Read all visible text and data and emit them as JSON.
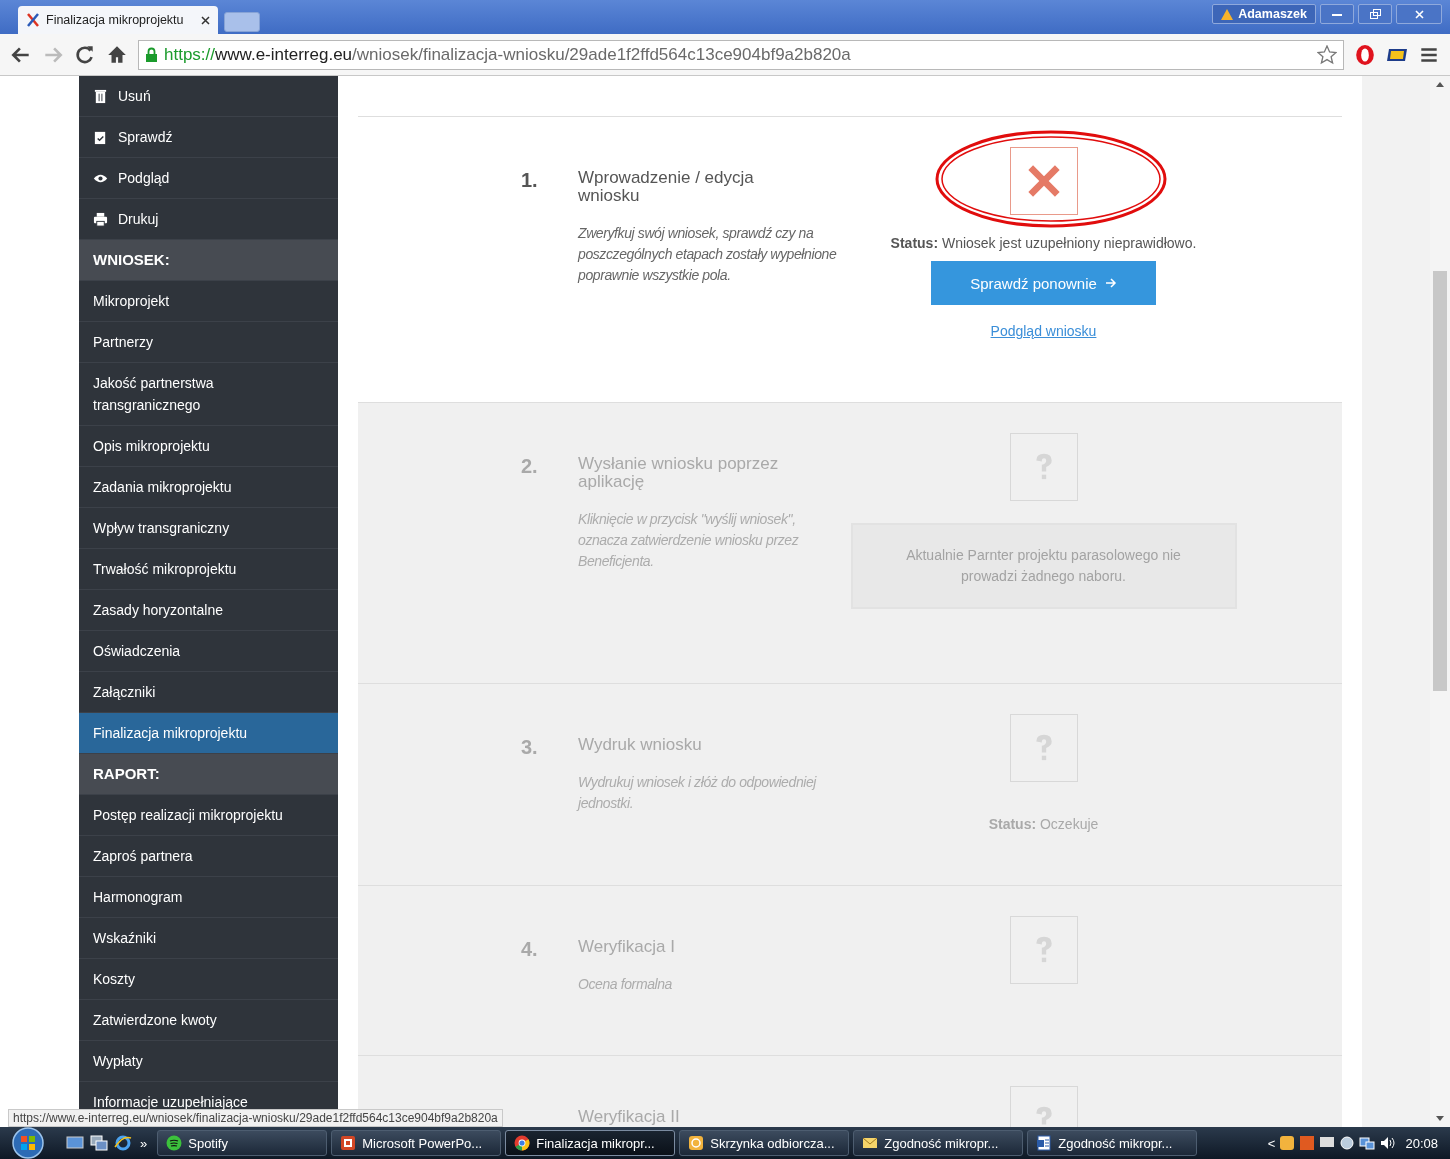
{
  "browser": {
    "tab": {
      "title": "Finalizacja mikroprojektu",
      "selected": true
    },
    "user": "Adamaszek",
    "url": {
      "scheme": "https://",
      "host": "www.e-interreg.eu",
      "path": "/wniosek/finalizacja-wniosku/29ade1f2ffd564c13ce904bf9a2b820a"
    }
  },
  "sidebar": {
    "items": [
      {
        "kind": "action",
        "label": "Usuń"
      },
      {
        "kind": "action",
        "label": "Sprawdź"
      },
      {
        "kind": "action",
        "label": "Podgląd"
      },
      {
        "kind": "action",
        "label": "Drukuj"
      },
      {
        "kind": "header",
        "label": "WNIOSEK:"
      },
      {
        "kind": "link",
        "label": "Mikroprojekt",
        "selected": false
      },
      {
        "kind": "link",
        "label": "Partnerzy",
        "selected": false
      },
      {
        "kind": "link",
        "label": "Jakość partnerstwa transgranicznego",
        "selected": false
      },
      {
        "kind": "link",
        "label": "Opis mikroprojektu",
        "selected": false
      },
      {
        "kind": "link",
        "label": "Zadania mikroprojektu",
        "selected": false
      },
      {
        "kind": "link",
        "label": "Wpływ transgraniczny",
        "selected": false
      },
      {
        "kind": "link",
        "label": "Trwałość mikroprojektu",
        "selected": false
      },
      {
        "kind": "link",
        "label": "Zasady horyzontalne",
        "selected": false
      },
      {
        "kind": "link",
        "label": "Oświadczenia",
        "selected": false
      },
      {
        "kind": "link",
        "label": "Załączniki",
        "selected": false
      },
      {
        "kind": "link",
        "label": "Finalizacja mikroprojektu",
        "selected": true
      },
      {
        "kind": "header",
        "label": "RAPORT:"
      },
      {
        "kind": "link",
        "label": "Postęp realizacji mikroprojektu",
        "selected": false
      },
      {
        "kind": "link",
        "label": "Zaproś partnera",
        "selected": false
      },
      {
        "kind": "link",
        "label": "Harmonogram",
        "selected": false
      },
      {
        "kind": "link",
        "label": "Wskaźniki",
        "selected": false
      },
      {
        "kind": "link",
        "label": "Koszty",
        "selected": false
      },
      {
        "kind": "link",
        "label": "Zatwierdzone kwoty",
        "selected": false
      },
      {
        "kind": "link",
        "label": "Wypłaty",
        "selected": false
      },
      {
        "kind": "link",
        "label": "Informacje uzupełniające",
        "selected": false
      }
    ]
  },
  "steps": [
    {
      "number": "1.",
      "title": "Wprowadzenie / edycja wniosku",
      "description": "Zweryfkuj swój wniosek, sprawdź czy na poszczególnych etapach zostały wypełnione poprawnie wszystkie pola.",
      "active": true,
      "kind": "error",
      "highlighted": true,
      "status_label": "Status:",
      "status_text": "Wniosek jest uzupełniony nieprawidłowo.",
      "button": "Sprawdź ponownie",
      "link": "Podgląd wniosku"
    },
    {
      "number": "2.",
      "title": "Wysłanie wniosku poprzez aplikację",
      "description": "Kliknięcie w przycisk \"wyślij wniosek\", oznacza zatwierdzenie wniosku przez Beneficjenta.",
      "active": false,
      "kind": "pending",
      "highlighted": false,
      "notice": "Aktualnie Parnter projektu parasolowego nie prowadzi żadnego naboru."
    },
    {
      "number": "3.",
      "title": "Wydruk wniosku",
      "description": "Wydrukuj wniosek i złóż do odpowiedniej jednostki.",
      "active": false,
      "kind": "pending",
      "highlighted": false,
      "status_label": "Status:",
      "status_text": "Oczekuje"
    },
    {
      "number": "4.",
      "title": "Weryfikacja I",
      "description": "Ocena formalna",
      "active": false,
      "kind": "pending",
      "highlighted": false
    },
    {
      "title": "Weryfikacja II",
      "active": false,
      "kind": "pending",
      "highlighted": false
    }
  ],
  "status_bubble": "https://www.e-interreg.eu/wniosek/finalizacja-wniosku/29ade1f2ffd564c13ce904bf9a2b820a",
  "taskbar": {
    "items": [
      {
        "label": "Spotify",
        "selected": false
      },
      {
        "label": "Microsoft PowerPo...",
        "selected": false
      },
      {
        "label": "Finalizacja mikropr...",
        "selected": true
      },
      {
        "label": "Skrzynka odbiorcza...",
        "selected": false
      },
      {
        "label": "Zgodność mikropr...",
        "selected": false
      },
      {
        "label": "Zgodność mikropr...",
        "selected": false
      }
    ],
    "more": "»",
    "tray_arrow": "<",
    "clock": "20:08"
  }
}
